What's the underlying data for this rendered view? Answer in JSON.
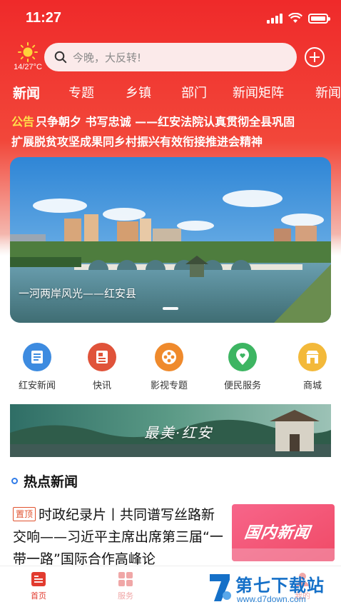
{
  "status_bar": {
    "time": "11:27"
  },
  "weather": {
    "temp": "14/27°C",
    "icon": "sun-icon"
  },
  "search": {
    "placeholder": "今晚，大反转!"
  },
  "tabs": [
    "新闻",
    "专题",
    "乡镇",
    "部门",
    "新闻矩阵",
    "新闻"
  ],
  "notice": {
    "tag": "公告",
    "line1": "只争朝夕 书写忠诚 ——红安法院认真贯彻全县巩固",
    "line2": "扩展脱贫攻坚成果同乡村振兴有效衔接推进会精神"
  },
  "banner": {
    "caption": "一河两岸风光——红安县"
  },
  "quick_links": [
    {
      "label": "红安新闻",
      "icon": "newspaper-icon",
      "color": "#3d8be0"
    },
    {
      "label": "快讯",
      "icon": "flash-news-icon",
      "color": "#e0533a"
    },
    {
      "label": "影视专题",
      "icon": "film-reel-icon",
      "color": "#ef8a2c"
    },
    {
      "label": "便民服务",
      "icon": "location-heart-icon",
      "color": "#3db562"
    },
    {
      "label": "商城",
      "icon": "shop-icon",
      "color": "#f3b93a"
    }
  ],
  "promo": {
    "text": "最美·红安"
  },
  "hot_news": {
    "title": "热点新闻",
    "items": [
      {
        "pin": "置顶",
        "title": "时政纪录片丨共同谱写丝路新交响——习近平主席出席第三届“一带一路”国际合作高峰论",
        "thumb_text": "国内新闻"
      }
    ]
  },
  "bottom_nav": [
    {
      "label": "首页",
      "icon": "home-news-icon",
      "active": true
    },
    {
      "label": "服务",
      "icon": "grid-icon",
      "active": false
    },
    {
      "label": "我的",
      "icon": "user-icon",
      "active": false
    }
  ],
  "watermark": {
    "title": "第七下载站",
    "subtitle": "www.d7down.com"
  },
  "colors": {
    "brand_red": "#ef2a2a",
    "tab_active": "#ffffff",
    "notice_tag": "#ffe14b"
  }
}
